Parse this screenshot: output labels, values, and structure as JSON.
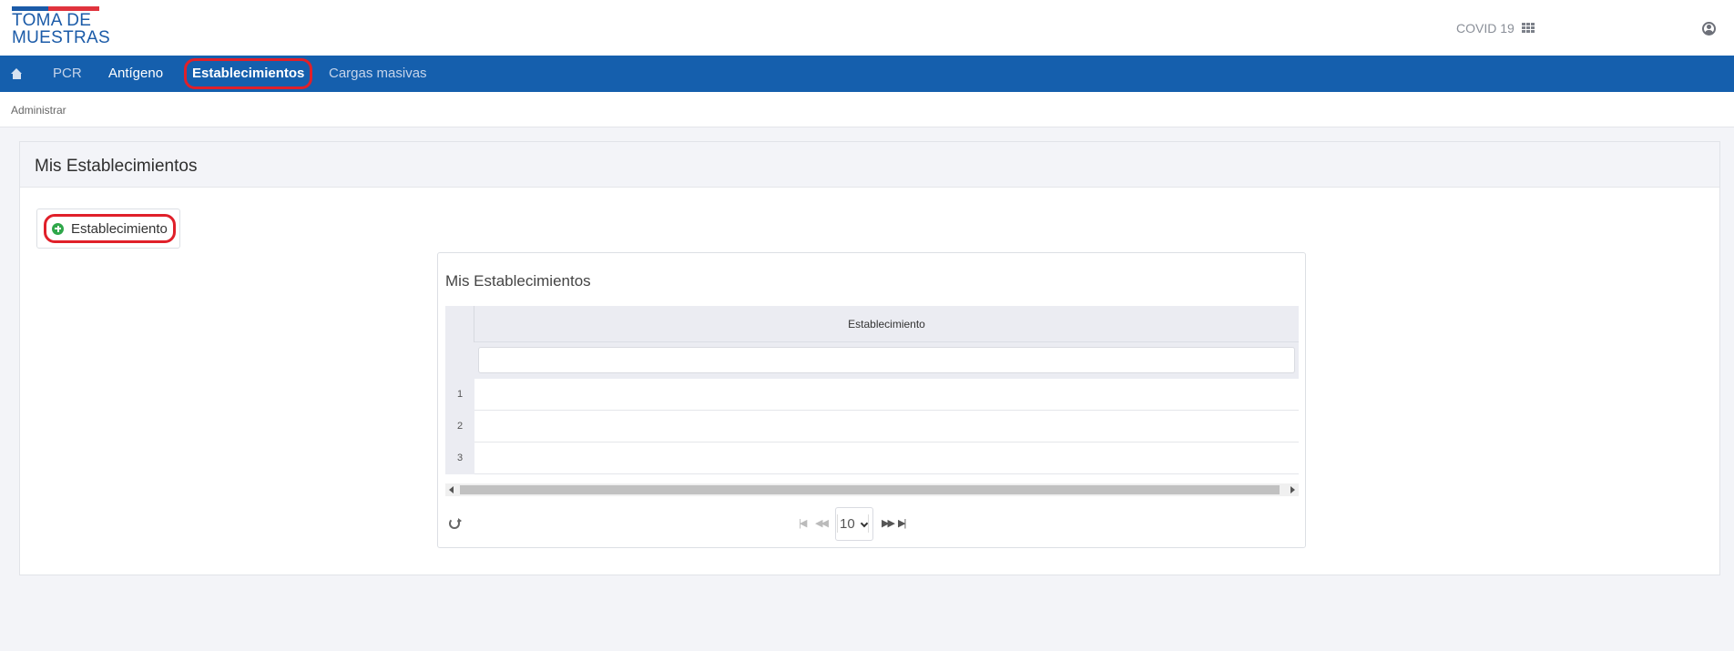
{
  "header": {
    "logo_line1": "TOMA DE",
    "logo_line2": "MUESTRAS",
    "covid_label": "COVID 19"
  },
  "nav": {
    "items": [
      {
        "label": "PCR"
      },
      {
        "label": "Antígeno"
      },
      {
        "label": "Establecimientos"
      },
      {
        "label": "Cargas masivas"
      }
    ]
  },
  "breadcrumb": {
    "label": "Administrar"
  },
  "panel": {
    "title": "Mis Establecimientos",
    "add_button_label": "Establecimiento"
  },
  "grid": {
    "title": "Mis Establecimientos",
    "column_header": "Establecimiento",
    "row_numbers": [
      "1",
      "2",
      "3"
    ],
    "page_size": "10"
  },
  "colors": {
    "navbar": "#155fad",
    "highlight": "#e0202a",
    "logo_blue": "#1b5ba8",
    "logo_red": "#e0333d",
    "add_icon": "#2fa74a"
  }
}
